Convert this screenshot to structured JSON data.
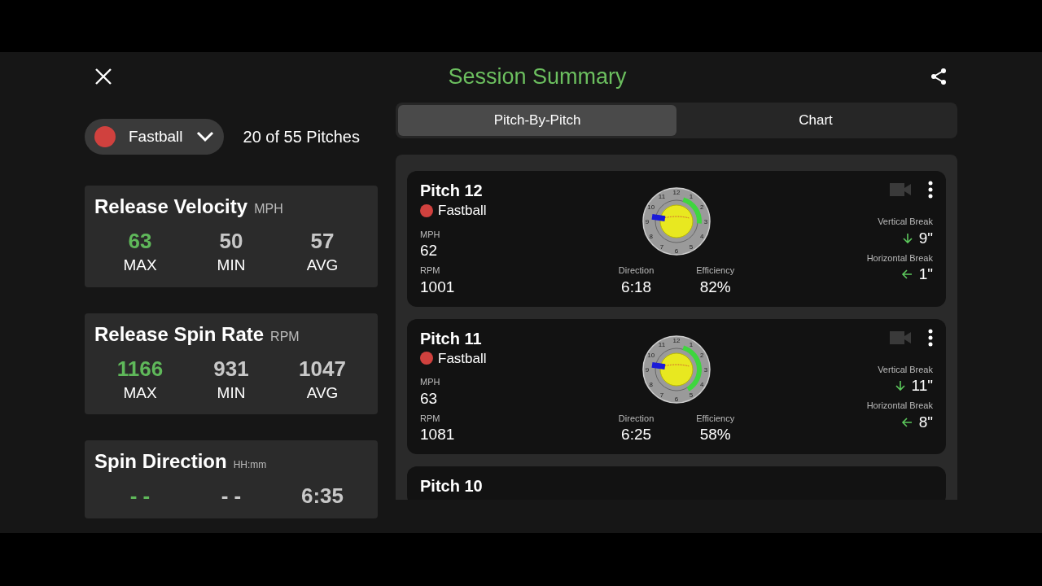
{
  "header": {
    "title": "Session Summary"
  },
  "filter": {
    "pitch_type": "Fastball",
    "color": "#d0413e",
    "count": "20 of 55 Pitches"
  },
  "tabs": [
    {
      "label": "Pitch-By-Pitch",
      "selected": true
    },
    {
      "label": "Chart",
      "selected": false
    }
  ],
  "stat_cards": [
    {
      "title": "Release Velocity",
      "unit": "MPH",
      "stats": [
        {
          "value": "63",
          "label": "MAX",
          "highlight": true
        },
        {
          "value": "50",
          "label": "MIN",
          "highlight": false
        },
        {
          "value": "57",
          "label": "AVG",
          "highlight": false
        }
      ]
    },
    {
      "title": "Release Spin Rate",
      "unit": "RPM",
      "stats": [
        {
          "value": "1166",
          "label": "MAX",
          "highlight": true
        },
        {
          "value": "931",
          "label": "MIN",
          "highlight": false
        },
        {
          "value": "1047",
          "label": "AVG",
          "highlight": false
        }
      ]
    },
    {
      "title": "Spin Direction",
      "unit": "HH:mm",
      "stats": [
        {
          "value": "- -",
          "highlight": true
        },
        {
          "value": "- -",
          "highlight": false
        },
        {
          "value": "6:35",
          "highlight": false
        }
      ]
    }
  ],
  "pitches": [
    {
      "title": "Pitch 12",
      "dial_labels": [
        "12",
        "1",
        "2",
        "3",
        "4",
        "5",
        "6",
        "7",
        "8",
        "9",
        "10",
        "11"
      ],
      "type": "Fastball",
      "color": "#d0413e",
      "mph_label": "MPH",
      "mph": "62",
      "rpm_label": "RPM",
      "rpm": "1001",
      "direction_label": "Direction",
      "direction": "6:18",
      "efficiency_label": "Efficiency",
      "efficiency": "82%",
      "vbreak_label": "Vertical Break",
      "vbreak": "9\"",
      "hbreak_label": "Horizontal Break",
      "hbreak": "1\""
    },
    {
      "title": "Pitch 11",
      "dial_labels": [
        "12",
        "1",
        "2",
        "3",
        "4",
        "5",
        "6",
        "7",
        "8",
        "9",
        "10",
        "11"
      ],
      "type": "Fastball",
      "color": "#d0413e",
      "mph_label": "MPH",
      "mph": "63",
      "rpm_label": "RPM",
      "rpm": "1081",
      "direction_label": "Direction",
      "direction": "6:25",
      "efficiency_label": "Efficiency",
      "efficiency": "58%",
      "vbreak_label": "Vertical Break",
      "vbreak": "11\"",
      "hbreak_label": "Horizontal Break",
      "hbreak": "8\""
    },
    {
      "title": "Pitch 10"
    }
  ]
}
